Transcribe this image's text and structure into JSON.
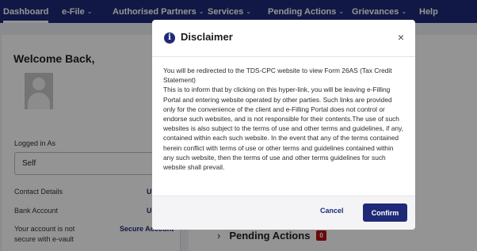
{
  "nav": {
    "items": [
      {
        "label": "Dashboard",
        "has_dropdown": false
      },
      {
        "label": "e-File",
        "has_dropdown": true
      },
      {
        "label": "Authorised Partners",
        "has_dropdown": true
      },
      {
        "label": "Services",
        "has_dropdown": true
      },
      {
        "label": "Pending Actions",
        "has_dropdown": true
      },
      {
        "label": "Grievances",
        "has_dropdown": true
      },
      {
        "label": "Help",
        "has_dropdown": false
      }
    ],
    "chevron": "⌄"
  },
  "profile": {
    "welcome": "Welcome Back,",
    "logged_in_as_label": "Logged in As",
    "logged_in_as_value": "Self",
    "contact_details_label": "Contact Details",
    "contact_details_link": "U",
    "bank_account_label": "Bank Account",
    "bank_account_link": "U",
    "vault_line1": "Your account is not",
    "vault_line2": "secure with e-vault",
    "vault_link": "Secure Account"
  },
  "pending": {
    "label": "Pending Actions",
    "count": "0"
  },
  "modal": {
    "title": "Disclaimer",
    "info_icon_glyph": "i",
    "close_glyph": "×",
    "body_p1": "You will be redirected to the TDS-CPC website to view Form 26AS (Tax Credit Statement)",
    "body_p2": "This is to inform that by clicking on this hyper-link, you will be leaving e-Filling Portal and entering website operated by other parties. Such links are provided only for the convenience of the client and e-Filling Portal does not control or endorse such websites, and is not responsible for their contents.The use of such websites is also subject to the terms of use and other terms and guidelines, if any, contained within each such website. In the event that any of the terms contained herein conflict with terms of use or other terms and guidelines contained within any such website, then the terms of use and other terms guidelines for such website shall prevail.",
    "cancel_label": "Cancel",
    "confirm_label": "Confirm"
  },
  "colors": {
    "brand": "#1e2a78",
    "badge": "#b31212"
  }
}
